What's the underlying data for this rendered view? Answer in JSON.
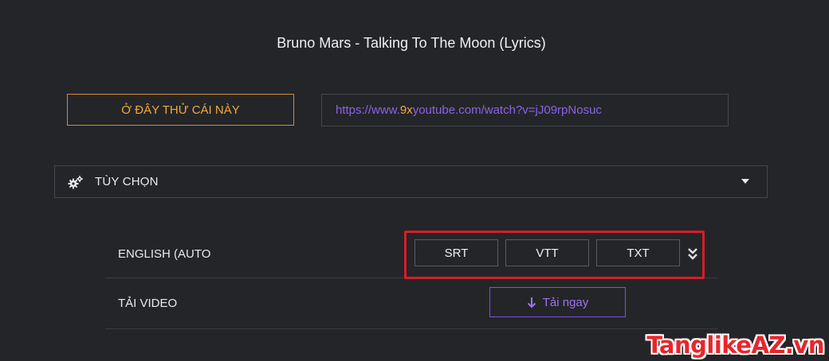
{
  "video": {
    "title": "Bruno Mars - Talking To The Moon (Lyrics)"
  },
  "try_button": {
    "label": "Ở ĐÂY THỬ CÁI NÀY"
  },
  "url": {
    "prefix": "https://www.",
    "highlight": "9x",
    "suffix": "youtube.com/watch?v=jJ09rpNosuc"
  },
  "options": {
    "icon": "gears-icon",
    "label": "TÙY CHỌN",
    "toggle_icon": "caret-down-icon"
  },
  "subtitles": {
    "language_label": "ENGLISH (AUTO",
    "formats": [
      "SRT",
      "VTT",
      "TXT"
    ],
    "more_icon": "double-chevron-down-icon"
  },
  "download": {
    "label": "TẢI VIDEO",
    "button_label": "Tải ngay",
    "button_icon": "arrow-down-icon"
  },
  "colors": {
    "background": "#242529",
    "accent_orange": "#f0a93c",
    "accent_purple": "#8a63e6",
    "highlight_red": "#d91c25"
  },
  "watermark": {
    "text": "TanglikeAZ.vn"
  }
}
